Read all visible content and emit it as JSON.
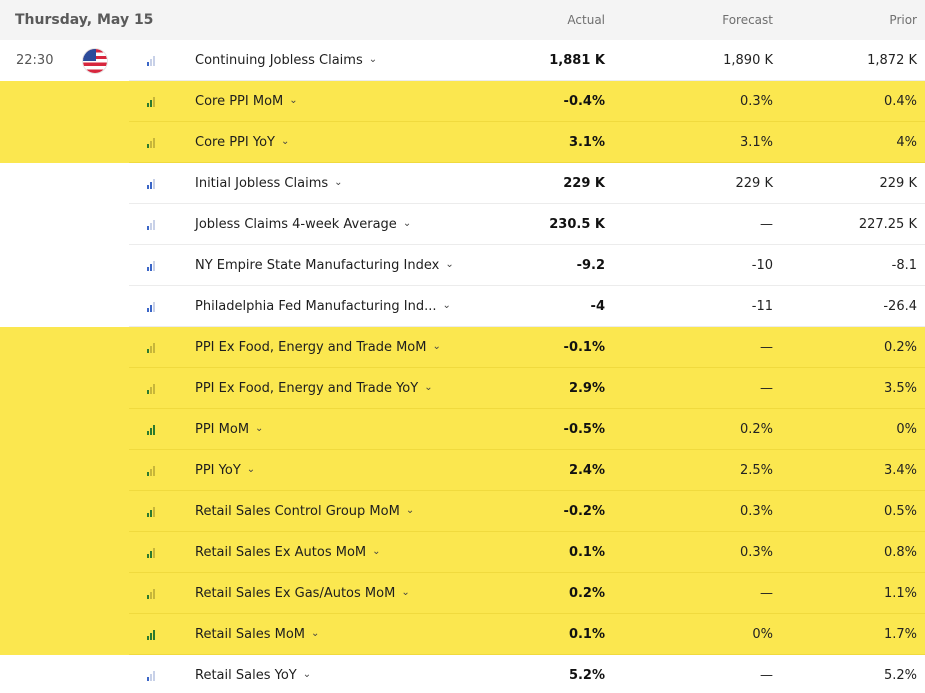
{
  "header": {
    "date": "Thursday, May 15",
    "col_actual": "Actual",
    "col_forecast": "Forecast",
    "col_prior": "Prior"
  },
  "rows": [
    {
      "time": "22:30",
      "flag": "us-flag-icon",
      "importance": 1,
      "name": "Continuing Jobless Claims",
      "actual": "1,881 K",
      "forecast": "1,890 K",
      "prior": "1,872 K",
      "highlight": false
    },
    {
      "time": "",
      "flag": "",
      "importance": 2,
      "name": "Core PPI MoM",
      "actual": "-0.4%",
      "forecast": "0.3%",
      "prior": "0.4%",
      "highlight": true
    },
    {
      "time": "",
      "flag": "",
      "importance": 1,
      "name": "Core PPI YoY",
      "actual": "3.1%",
      "forecast": "3.1%",
      "prior": "4%",
      "highlight": true
    },
    {
      "time": "",
      "flag": "",
      "importance": 2,
      "name": "Initial Jobless Claims",
      "actual": "229 K",
      "forecast": "229 K",
      "prior": "229 K",
      "highlight": false
    },
    {
      "time": "",
      "flag": "",
      "importance": 1,
      "name": "Jobless Claims 4-week Average",
      "actual": "230.5 K",
      "forecast": "—",
      "prior": "227.25 K",
      "highlight": false
    },
    {
      "time": "",
      "flag": "",
      "importance": 2,
      "name": "NY Empire State Manufacturing Index",
      "actual": "-9.2",
      "forecast": "-10",
      "prior": "-8.1",
      "highlight": false
    },
    {
      "time": "",
      "flag": "",
      "importance": 2,
      "name": "Philadelphia Fed Manufacturing Ind...",
      "actual": "-4",
      "forecast": "-11",
      "prior": "-26.4",
      "highlight": false
    },
    {
      "time": "",
      "flag": "",
      "importance": 1,
      "name": "PPI Ex Food, Energy and Trade MoM",
      "actual": "-0.1%",
      "forecast": "—",
      "prior": "0.2%",
      "highlight": true
    },
    {
      "time": "",
      "flag": "",
      "importance": 1,
      "name": "PPI Ex Food, Energy and Trade YoY",
      "actual": "2.9%",
      "forecast": "—",
      "prior": "3.5%",
      "highlight": true
    },
    {
      "time": "",
      "flag": "",
      "importance": 3,
      "name": "PPI MoM",
      "actual": "-0.5%",
      "forecast": "0.2%",
      "prior": "0%",
      "highlight": true
    },
    {
      "time": "",
      "flag": "",
      "importance": 1,
      "name": "PPI YoY",
      "actual": "2.4%",
      "forecast": "2.5%",
      "prior": "3.4%",
      "highlight": true
    },
    {
      "time": "",
      "flag": "",
      "importance": 2,
      "name": "Retail Sales Control Group MoM",
      "actual": "-0.2%",
      "forecast": "0.3%",
      "prior": "0.5%",
      "highlight": true
    },
    {
      "time": "",
      "flag": "",
      "importance": 2,
      "name": "Retail Sales Ex Autos MoM",
      "actual": "0.1%",
      "forecast": "0.3%",
      "prior": "0.8%",
      "highlight": true
    },
    {
      "time": "",
      "flag": "",
      "importance": 1,
      "name": "Retail Sales Ex Gas/Autos MoM",
      "actual": "0.2%",
      "forecast": "—",
      "prior": "1.1%",
      "highlight": true
    },
    {
      "time": "",
      "flag": "",
      "importance": 3,
      "name": "Retail Sales MoM",
      "actual": "0.1%",
      "forecast": "0%",
      "prior": "1.7%",
      "highlight": true
    },
    {
      "time": "",
      "flag": "",
      "importance": 1,
      "name": "Retail Sales YoY",
      "actual": "5.2%",
      "forecast": "—",
      "prior": "5.2%",
      "highlight": false
    }
  ],
  "colors": {
    "highlight": "#fbe74f",
    "header_bg": "#f4f4f4",
    "importance_blue": "#3b66c7",
    "importance_green": "#2d7a2d"
  }
}
